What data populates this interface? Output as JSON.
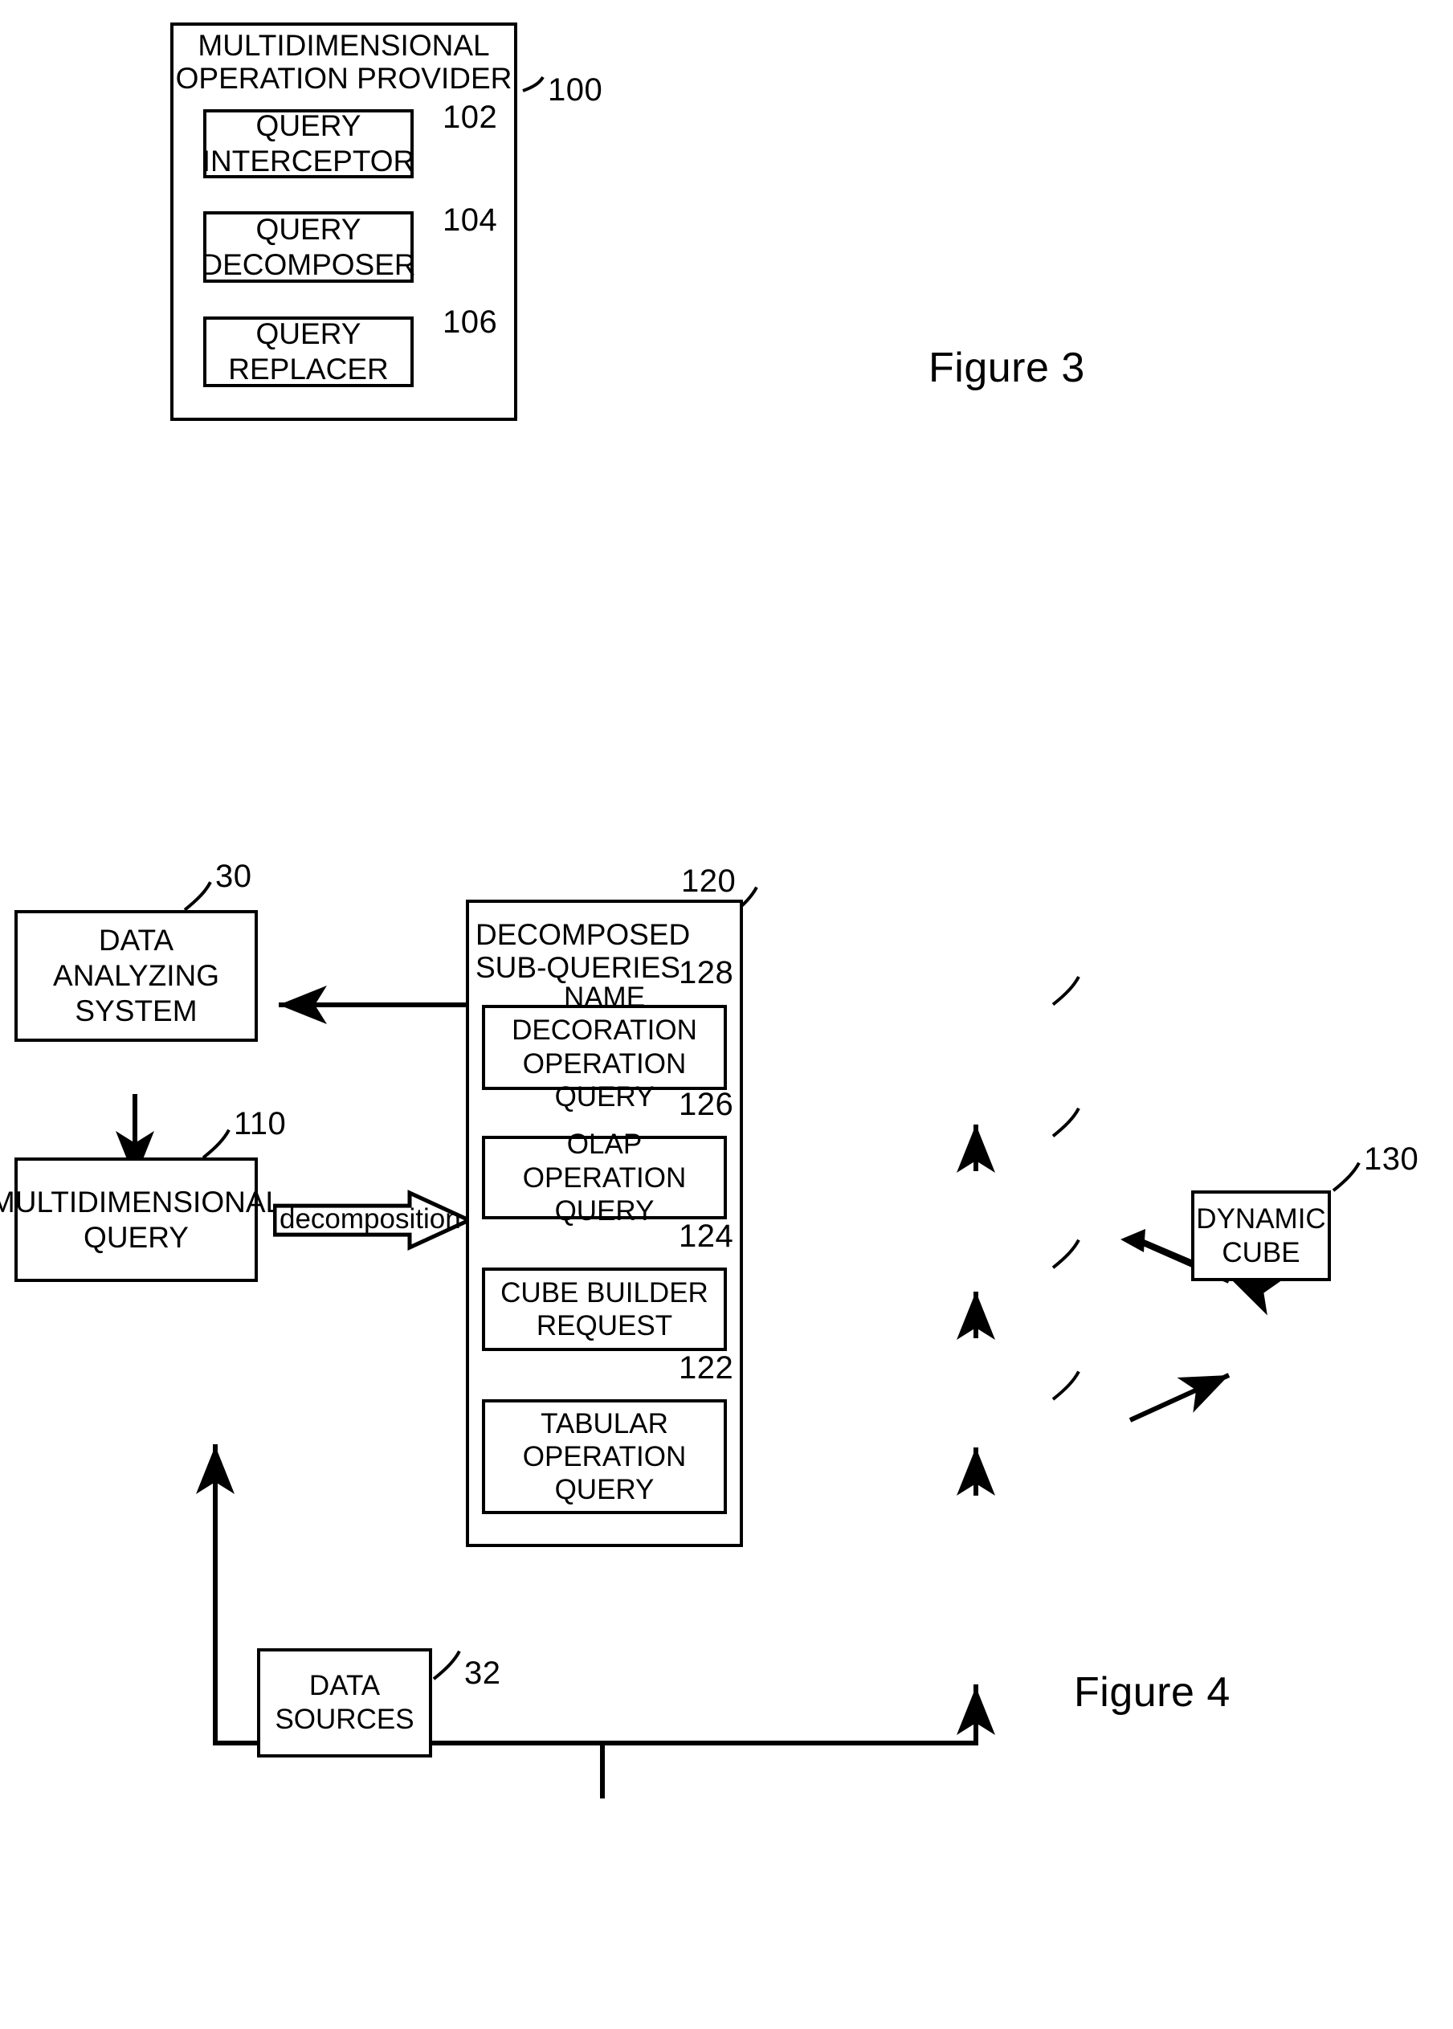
{
  "figure3": {
    "caption": "Figure 3",
    "container": {
      "title": "MULTIDIMENSIONAL\nOPERATION PROVIDER",
      "ref": "100"
    },
    "blocks": [
      {
        "label": "QUERY\nINTERCEPTOR",
        "ref": "102"
      },
      {
        "label": "QUERY\nDECOMPOSER",
        "ref": "104"
      },
      {
        "label": "QUERY\nREPLACER",
        "ref": "106"
      }
    ]
  },
  "figure4": {
    "caption": "Figure 4",
    "data_analyzing_system": {
      "label": "DATA ANALYZING\nSYSTEM",
      "ref": "30"
    },
    "multidimensional_query": {
      "label": "MULTIDIMENSIONAL\nQUERY",
      "ref": "110"
    },
    "decomposition_arrow": {
      "label": "decomposition"
    },
    "decomposed_subqueries": {
      "title": "DECOMPOSED\nSUB-QUERIES",
      "ref": "120",
      "blocks": [
        {
          "label": "NAME DECORATION\nOPERATION QUERY",
          "ref": "128"
        },
        {
          "label": "OLAP OPERATION\nQUERY",
          "ref": "126"
        },
        {
          "label": "CUBE BUILDER\nREQUEST",
          "ref": "124"
        },
        {
          "label": "TABULAR\nOPERATION\nQUERY",
          "ref": "122"
        }
      ]
    },
    "dynamic_cube": {
      "label": "DYNAMIC\nCUBE",
      "ref": "130"
    },
    "data_sources": {
      "label": "DATA\nSOURCES",
      "ref": "32"
    }
  },
  "colors": {
    "ink": "#000000",
    "paper": "#ffffff"
  }
}
